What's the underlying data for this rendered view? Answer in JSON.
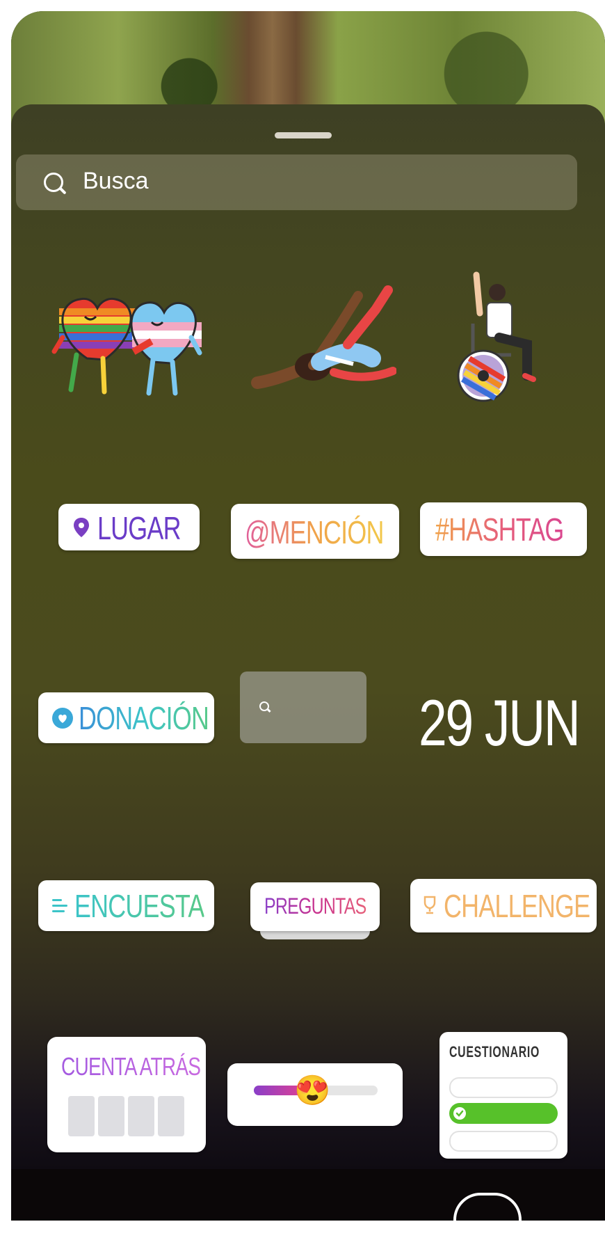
{
  "search": {
    "placeholder": "Busca"
  },
  "stickers": {
    "lugar": "LUGAR",
    "mencion": "@MENCIÓN",
    "hashtag": "#HASHTAG",
    "donacion": "DONACIÓN",
    "date": "29 JUN",
    "encuesta": "ENCUESTA",
    "preguntas": "PREGUNTAS",
    "challenge": "CHALLENGE",
    "cuenta_atras": "CUENTA ATRÁS",
    "emoji_slider_emoji": "😍",
    "cuestionario": "CUESTIONARIO"
  },
  "colors": {
    "lugar": "#7a3fc2",
    "mencion": "#f0a24a",
    "hashtag": "#e6607a",
    "donacion": "#3aa8d8",
    "encuesta": "#3cc4c8",
    "preguntas": "#c8328f",
    "challenge": "#f2b46a",
    "cuenta_atras": "#a45ae0",
    "quiz_green": "#57c12a"
  }
}
